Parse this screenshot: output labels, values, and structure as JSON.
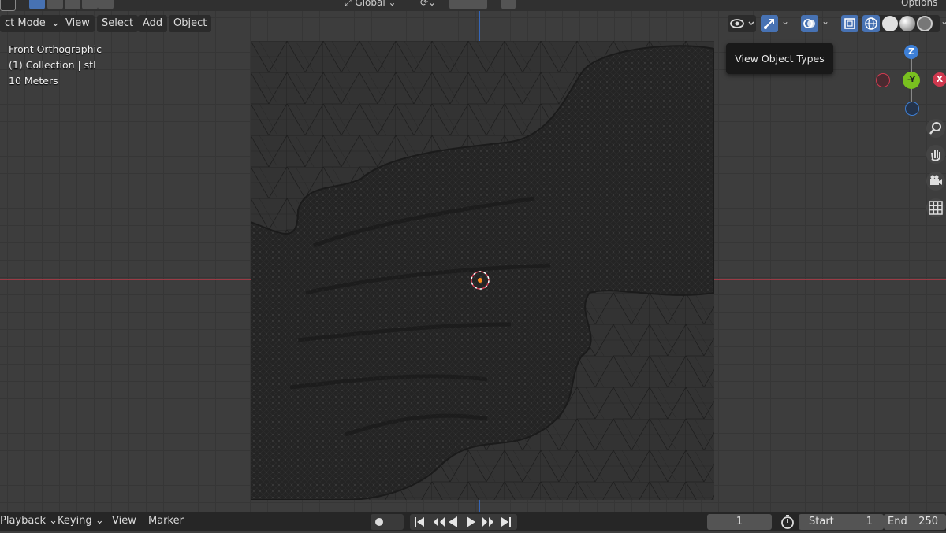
{
  "header": {
    "mode_label": "ct Mode",
    "menu": [
      "View",
      "Select",
      "Add",
      "Object"
    ],
    "orientation_label": "Global",
    "options_label": "Options"
  },
  "viewport": {
    "view_name": "Front Orthographic",
    "collection_info": "(1) Collection | stl",
    "scale_info": "10 Meters",
    "tooltip": "View Object Types"
  },
  "gizmo": {
    "z_label": "Z",
    "y_label": "-Y",
    "x_label": "X"
  },
  "footer": {
    "playback_label": "Playback",
    "keying_label": "Keying",
    "view_label": "View",
    "marker_label": "Marker",
    "current_frame": "1",
    "start_label": "Start",
    "start_value": "1",
    "end_label": "End",
    "end_value": "250"
  },
  "colors": {
    "accent": "#4772b3",
    "x_axis": "#d0394f",
    "y_axis": "#79c01f",
    "z_axis": "#3d7fd6",
    "origin": "#ff8c1a"
  }
}
